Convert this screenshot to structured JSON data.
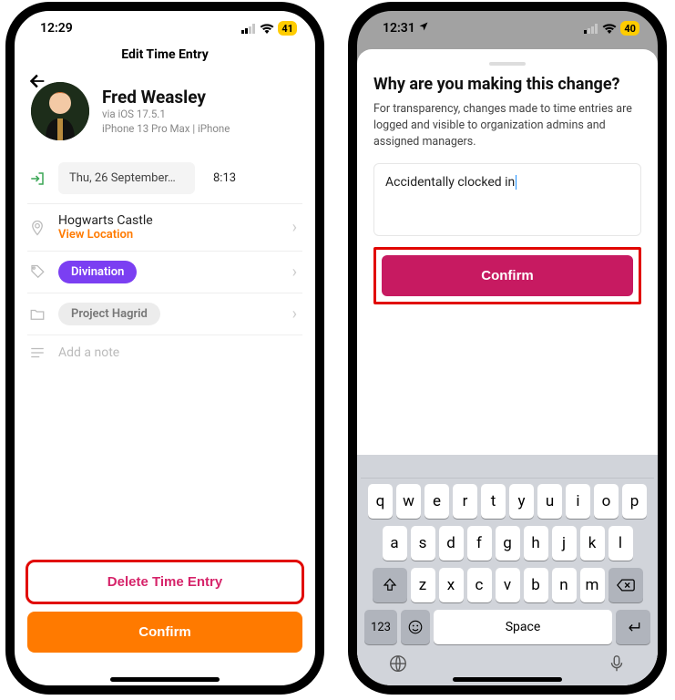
{
  "left": {
    "status_time": "12:29",
    "battery": "41",
    "title": "Edit Time Entry",
    "user": {
      "name": "Fred Weasley",
      "meta1": "via iOS 17.5.1",
      "meta2": "iPhone 13 Pro Max | iPhone"
    },
    "date": "Thu, 26 September…",
    "time": "8:13",
    "location": "Hogwarts Castle",
    "view_location": "View Location",
    "tag": "Divination",
    "project": "Project Hagrid",
    "note_placeholder": "Add a note",
    "delete_label": "Delete Time Entry",
    "confirm_label": "Confirm"
  },
  "right": {
    "status_time": "12:31",
    "battery": "40",
    "title": "Why are you making this change?",
    "desc": "For transparency, changes made to time entries are logged and visible to organization admins and assigned managers.",
    "reason_text": "Accidentally clocked in",
    "confirm_label": "Confirm",
    "keyboard": {
      "row1": [
        "q",
        "w",
        "e",
        "r",
        "t",
        "y",
        "u",
        "i",
        "o",
        "p"
      ],
      "row2": [
        "a",
        "s",
        "d",
        "f",
        "g",
        "h",
        "j",
        "k",
        "l"
      ],
      "row3": [
        "z",
        "x",
        "c",
        "v",
        "b",
        "n",
        "m"
      ],
      "num_key": "123",
      "space": "Space"
    }
  }
}
